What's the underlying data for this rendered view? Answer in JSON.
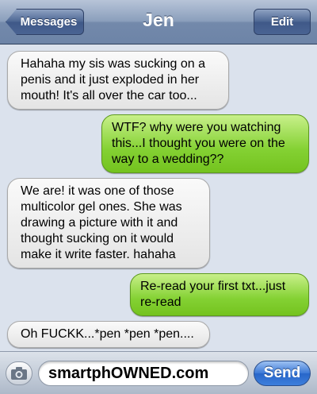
{
  "navbar": {
    "back_label": "Messages",
    "title": "Jen",
    "edit_label": "Edit"
  },
  "messages": [
    {
      "direction": "incoming",
      "text": "Hahaha my sis was sucking on a penis and it just exploded in her mouth! It's all over the car too..."
    },
    {
      "direction": "outgoing",
      "text": "WTF? why were you watching this...I thought you were on the way to a wedding??"
    },
    {
      "direction": "incoming",
      "text": "We are! it was one of those multicolor gel ones. She was drawing a picture with it and thought sucking on it would make it write faster. hahaha"
    },
    {
      "direction": "outgoing",
      "text": "Re-read your first txt...just re-read"
    },
    {
      "direction": "incoming",
      "text": "Oh FUCKK...*pen *pen *pen...."
    }
  ],
  "composer": {
    "camera_icon": "camera-icon",
    "input_value": "smartphOWNED.com",
    "send_label": "Send"
  },
  "colors": {
    "navbar": "#7d93b5",
    "incoming_bubble": "#e9e9e9",
    "outgoing_bubble": "#84d133",
    "send_button": "#3a78d6",
    "background": "#dbe2ed"
  }
}
